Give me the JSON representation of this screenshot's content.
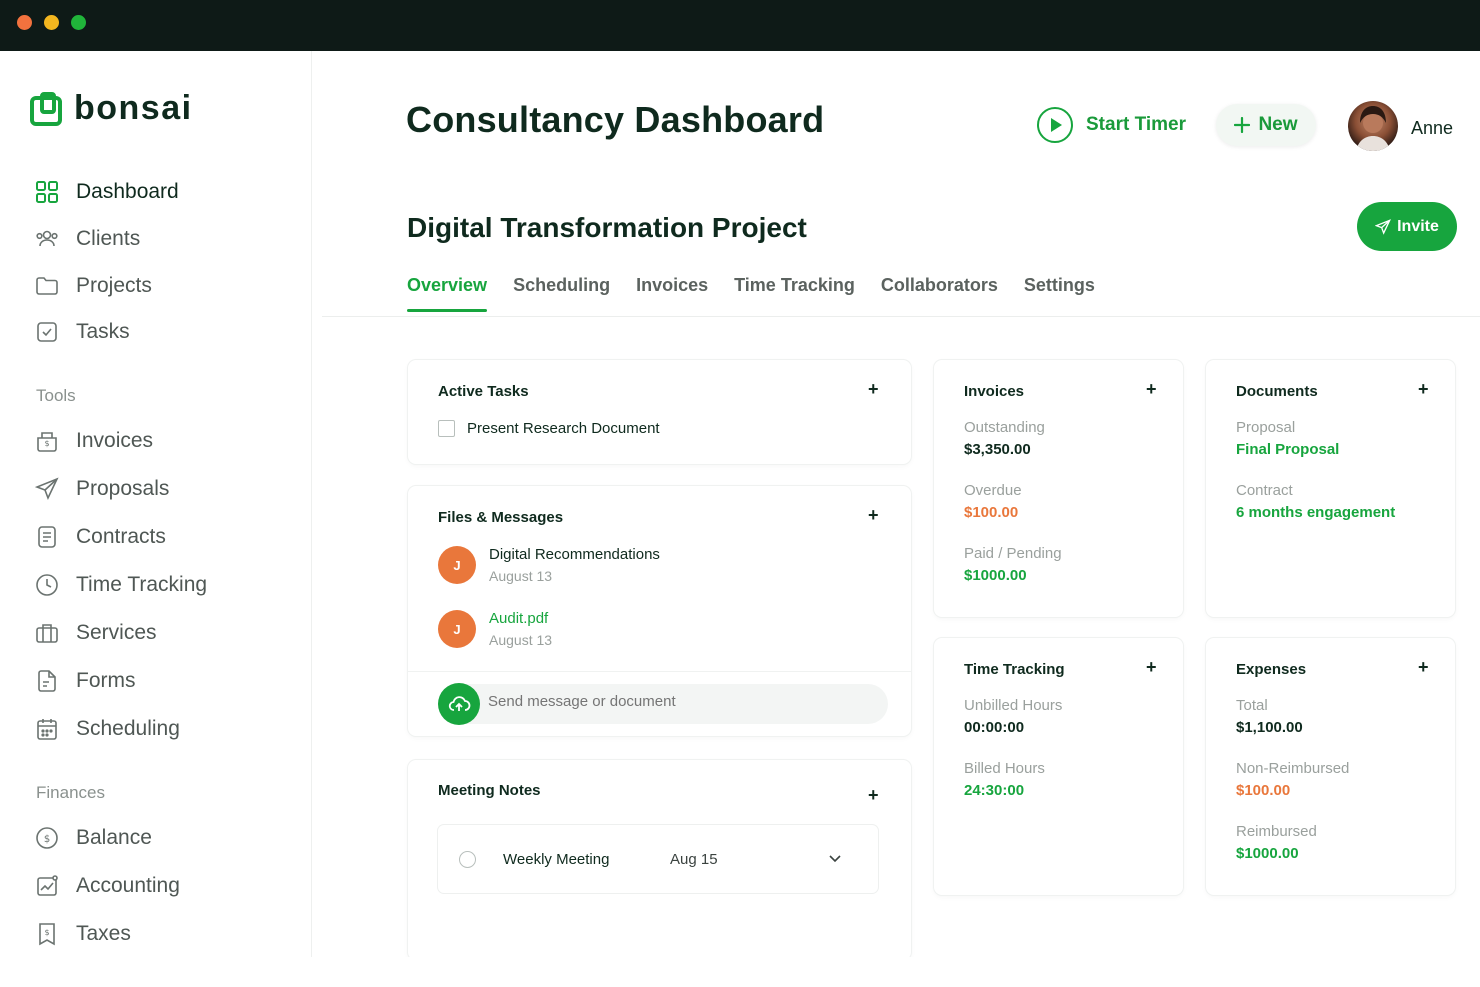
{
  "brand": {
    "name": "bonsai",
    "accent": "#17a53e",
    "dark": "#0f2a1e",
    "orange": "#e9773b"
  },
  "sidebar": {
    "main_items": [
      {
        "label": "Dashboard",
        "icon": "grid-icon",
        "active": true
      },
      {
        "label": "Clients",
        "icon": "users-icon"
      },
      {
        "label": "Projects",
        "icon": "folder-icon"
      },
      {
        "label": "Tasks",
        "icon": "check-square-icon"
      }
    ],
    "tools_label": "Tools",
    "tools_items": [
      {
        "label": "Invoices",
        "icon": "invoice-icon"
      },
      {
        "label": "Proposals",
        "icon": "send-icon"
      },
      {
        "label": "Contracts",
        "icon": "document-icon"
      },
      {
        "label": "Time Tracking",
        "icon": "clock-icon"
      },
      {
        "label": "Services",
        "icon": "briefcase-icon"
      },
      {
        "label": "Forms",
        "icon": "form-icon"
      },
      {
        "label": "Scheduling",
        "icon": "calendar-icon"
      }
    ],
    "finances_label": "Finances",
    "finances_items": [
      {
        "label": "Balance",
        "icon": "dollar-circle-icon"
      },
      {
        "label": "Accounting",
        "icon": "chart-line-icon"
      },
      {
        "label": "Taxes",
        "icon": "receipt-icon"
      }
    ]
  },
  "header": {
    "title": "Consultancy Dashboard",
    "start_timer": "Start Timer",
    "new_label": "New",
    "user_name": "Anne"
  },
  "project": {
    "title": "Digital Transformation Project",
    "invite_label": "Invite",
    "tabs": [
      "Overview",
      "Scheduling",
      "Invoices",
      "Time Tracking",
      "Collaborators",
      "Settings"
    ],
    "active_tab": "Overview"
  },
  "active_tasks": {
    "title": "Active Tasks",
    "plus": "+",
    "tasks": [
      {
        "label": "Present Research Document",
        "done": false
      }
    ]
  },
  "files_messages": {
    "title": "Files & Messages",
    "plus": "+",
    "items": [
      {
        "initial": "J",
        "title": "Digital Recommendations",
        "date": "August 13"
      },
      {
        "initial": "J",
        "title": "Audit.pdf",
        "date": "August 13"
      }
    ],
    "composer_placeholder": "Send message or document"
  },
  "meeting_notes": {
    "title": "Meeting Notes",
    "plus": "+",
    "meeting": {
      "name": "Weekly Meeting",
      "date": "Aug 15"
    }
  },
  "invoices": {
    "title": "Invoices",
    "plus": "+",
    "outstanding_label": "Outstanding",
    "outstanding_value": "$3,350.00",
    "overdue_label": "Overdue",
    "overdue_value": "$100.00",
    "paid_label": "Paid / Pending",
    "paid_value": "$1000.00"
  },
  "documents": {
    "title": "Documents",
    "plus": "+",
    "proposal_label": "Proposal",
    "proposal_value": "Final Proposal",
    "contract_label": "Contract",
    "contract_value": "6 months engagement"
  },
  "time_tracking": {
    "title": "Time Tracking",
    "plus": "+",
    "unbilled_label": "Unbilled Hours",
    "unbilled_value": "00:00:00",
    "billed_label": "Billed Hours",
    "billed_value": "24:30:00"
  },
  "expenses": {
    "title": "Expenses",
    "plus": "+",
    "total_label": "Total",
    "total_value": "$1,100.00",
    "non_reimbursed_label": "Non-Reimbursed",
    "non_reimbursed_value": "$100.00",
    "reimbursed_label": "Reimbursed",
    "reimbursed_value": "$1000.00"
  }
}
